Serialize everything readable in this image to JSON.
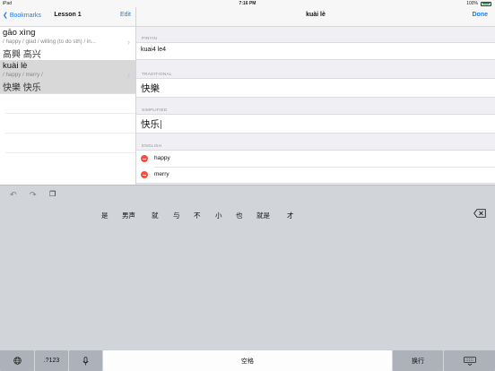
{
  "status": {
    "device": "iPad",
    "time": "7:16 PM",
    "battery": "100%"
  },
  "left": {
    "back_label": "Bookmarks",
    "title": "Lesson 1",
    "edit_label": "Edit",
    "rows": [
      {
        "pinyin": "gāo xìng",
        "english": "/ happy / glad / willing (to do sth) / in...",
        "chars": "高興 高兴"
      },
      {
        "pinyin": "kuài lè",
        "english": "/ happy / merry /",
        "chars": "快樂 快乐"
      }
    ]
  },
  "right": {
    "title": "kuài lè",
    "done_label": "Done",
    "pinyin_header": "PINYIN",
    "pinyin_value": "kuai4 le4",
    "traditional_header": "TRADITIONAL",
    "traditional_value": "快樂",
    "simplified_header": "SIMPLIFIED",
    "simplified_value": "快乐",
    "english_header": "ENGLISH",
    "english_items": [
      "happy",
      "merry"
    ]
  },
  "keyboard": {
    "toolbar_icons": [
      "undo-icon",
      "redo-icon",
      "paste-icon"
    ],
    "candidates": [
      "是",
      "男声",
      "就",
      "与",
      "不",
      "小",
      "也",
      "就是",
      "才"
    ],
    "globe_icon": "globe-icon",
    "num_label": ".?123",
    "mic_icon": "microphone-icon",
    "space_label": "空格",
    "return_label": "换行",
    "dismiss_icon": "keyboard-dismiss-icon",
    "delete_icon": "delete-icon"
  }
}
